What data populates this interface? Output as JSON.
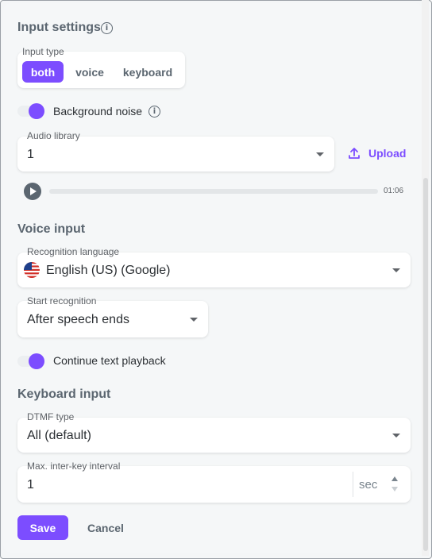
{
  "input_settings": {
    "title": "Input settings",
    "input_type": {
      "label": "Input type",
      "options": [
        "both",
        "voice",
        "keyboard"
      ],
      "selected": "both"
    },
    "background_noise": {
      "label": "Background noise",
      "enabled": true
    },
    "audio_library": {
      "label": "Audio library",
      "value": "1"
    },
    "upload_label": "Upload",
    "player": {
      "duration": "01:06",
      "progress": 0
    }
  },
  "voice_input": {
    "title": "Voice input",
    "recognition_language": {
      "label": "Recognition language",
      "value": "English (US) (Google)",
      "flag": "us-flag"
    },
    "start_recognition": {
      "label": "Start recognition",
      "value": "After speech ends"
    },
    "continue_text_playback": {
      "label": "Continue text playback",
      "enabled": true
    }
  },
  "keyboard_input": {
    "title": "Keyboard input",
    "dtmf_type": {
      "label": "DTMF type",
      "value": "All (default)"
    },
    "max_inter_key": {
      "label": "Max. inter-key interval",
      "value": "1",
      "unit": "sec"
    }
  },
  "actions": {
    "save": "Save",
    "cancel": "Cancel"
  },
  "colors": {
    "accent": "#7c4dff",
    "muted_text": "#5b6670"
  }
}
